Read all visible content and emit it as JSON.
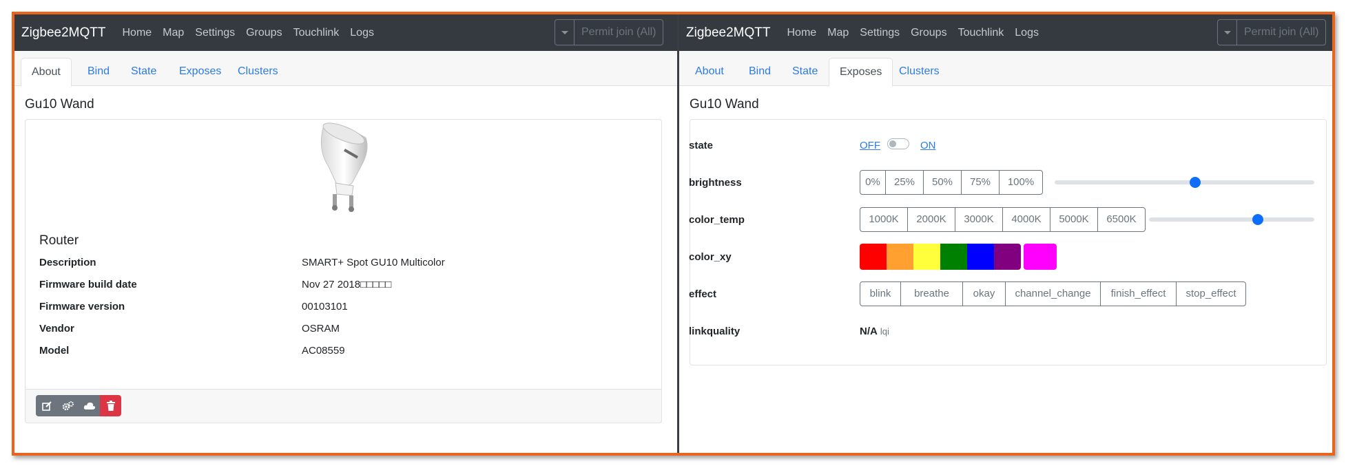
{
  "left": {
    "navbar": {
      "brand": "Zigbee2MQTT",
      "links": [
        "Home",
        "Map",
        "Settings",
        "Groups",
        "Touchlink",
        "Logs"
      ],
      "permit_join": "Permit join (All)"
    },
    "tabs": [
      "About",
      "Bind",
      "State",
      "Exposes",
      "Clusters"
    ],
    "active_tab": "About",
    "device_title": "Gu10 Wand",
    "device_type": "Router",
    "info": [
      {
        "key": "Description",
        "value": "SMART+ Spot GU10 Multicolor"
      },
      {
        "key": "Firmware build date",
        "value": "Nov 27 2018□□□□□"
      },
      {
        "key": "Firmware version",
        "value": "00103101"
      },
      {
        "key": "Vendor",
        "value": "OSRAM"
      },
      {
        "key": "Model",
        "value": "AC08559"
      }
    ],
    "actions": [
      "edit-icon",
      "cogs-icon",
      "cloud-icon",
      "trash-icon"
    ]
  },
  "right": {
    "navbar": {
      "brand": "Zigbee2MQTT",
      "links": [
        "Home",
        "Map",
        "Settings",
        "Groups",
        "Touchlink",
        "Logs"
      ],
      "permit_join": "Permit join (All)"
    },
    "tabs": [
      "About",
      "Bind",
      "State",
      "Exposes",
      "Clusters"
    ],
    "active_tab": "Exposes",
    "device_title": "Gu10 Wand",
    "exposes": {
      "state": {
        "label": "state",
        "off": "OFF",
        "on": "ON",
        "value": "OFF"
      },
      "brightness": {
        "label": "brightness",
        "presets": [
          "0%",
          "25%",
          "50%",
          "75%",
          "100%"
        ],
        "value_fraction": 0.54
      },
      "color_temp": {
        "label": "color_temp",
        "presets": [
          "1000K",
          "2000K",
          "3000K",
          "4000K",
          "5000K",
          "6500K"
        ],
        "value_fraction": 0.66
      },
      "color_xy": {
        "label": "color_xy",
        "presets": [
          "#ff0000",
          "#ffa030",
          "#ffff3c",
          "#008000",
          "#0000ff",
          "#800080"
        ],
        "current": "#ff00ff"
      },
      "effect": {
        "label": "effect",
        "options": [
          "blink",
          "breathe",
          "okay",
          "channel_change",
          "finish_effect",
          "stop_effect"
        ]
      },
      "linkquality": {
        "label": "linkquality",
        "value": "N/A",
        "unit": "lqi"
      }
    }
  }
}
